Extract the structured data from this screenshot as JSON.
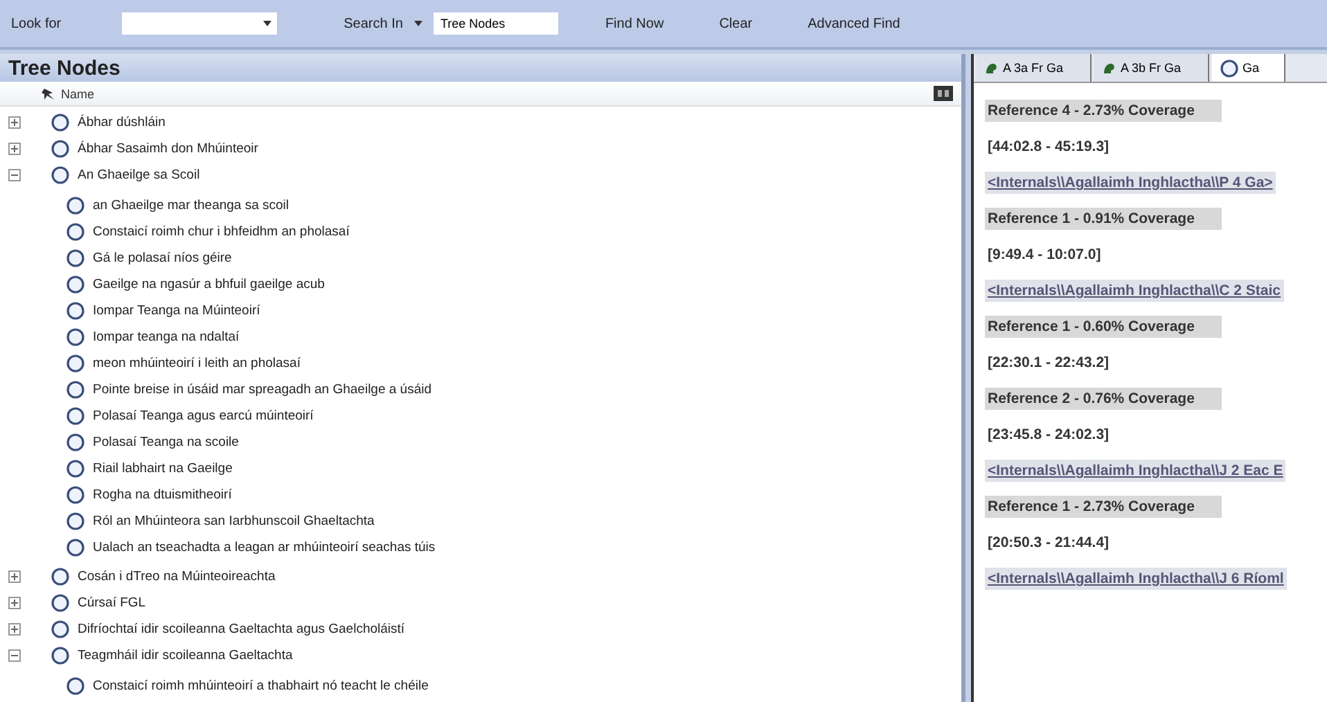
{
  "toolbar": {
    "look_for_label": "Look for",
    "search_in_label": "Search In",
    "search_in": {
      "value": "Tree Nodes"
    },
    "buttons": [
      "Find Now",
      "Clear",
      "Advanced Find"
    ]
  },
  "tree_panel": {
    "title": "Tree Nodes",
    "column": "Name",
    "nodes": [
      {
        "label": "Ábhar dúshláin",
        "expanded": false
      },
      {
        "label": "Ábhar Sasaimh don Mhúinteoir",
        "expanded": false
      },
      {
        "label": "An Ghaeilge sa Scoil",
        "expanded": true,
        "children": [
          {
            "label": "an Ghaeilge mar theanga sa scoil"
          },
          {
            "label": "Constaicí roimh chur i bhfeidhm an pholasaí"
          },
          {
            "label": "Gá le polasaí níos géire"
          },
          {
            "label": "Gaeilge na ngasúr a bhfuil gaeilge acub"
          },
          {
            "label": "Iompar Teanga na Múinteoirí"
          },
          {
            "label": "Iompar teanga na ndaltaí"
          },
          {
            "label": "meon mhúinteoirí i leith an pholasaí"
          },
          {
            "label": "Pointe breise in úsáid mar spreagadh an Ghaeilge a úsáid"
          },
          {
            "label": "Polasaí Teanga agus earcú múinteoirí"
          },
          {
            "label": "Polasaí Teanga na scoile"
          },
          {
            "label": "Riail labhairt na Gaeilge"
          },
          {
            "label": "Rogha na dtuismitheoirí"
          },
          {
            "label": "Ról an Mhúinteora san Iarbhunscoil Ghaeltachta"
          },
          {
            "label": "Ualach an tseachadta a leagan ar mhúinteoirí seachas túis"
          }
        ]
      },
      {
        "label": "Cosán i dTreo na Múinteoireachta",
        "expanded": false
      },
      {
        "label": "Cúrsaí FGL",
        "expanded": false
      },
      {
        "label": "Difríochtaí idir scoileanna Gaeltachta agus Gaelcholáistí",
        "expanded": false
      },
      {
        "label": "Teagmháil idir scoileanna Gaeltachta",
        "expanded": true,
        "children": [
          {
            "label": "Constaicí roimh mhúinteoirí a thabhairt nó teacht le chéile"
          }
        ]
      }
    ]
  },
  "detail_panel": {
    "tabs": [
      {
        "label": "A 3a Fr Ga",
        "kind": "case",
        "selected": false
      },
      {
        "label": "A 3b Fr Ga",
        "kind": "case",
        "selected": false
      },
      {
        "label": "Ga",
        "kind": "node",
        "selected": true
      }
    ],
    "entries": [
      {
        "kind": "reference",
        "text": "Reference 4 - 2.73% Coverage"
      },
      {
        "kind": "range",
        "text": "[44:02.8 - 45:19.3]"
      },
      {
        "kind": "link",
        "text": "<Internals\\\\Agallaimh Inghlactha\\\\P 4 Ga>"
      },
      {
        "kind": "reference",
        "text": "Reference 1 - 0.91% Coverage"
      },
      {
        "kind": "range",
        "text": "[9:49.4 - 10:07.0]"
      },
      {
        "kind": "link",
        "text": "<Internals\\\\Agallaimh Inghlactha\\\\C 2 Staic"
      },
      {
        "kind": "reference",
        "text": "Reference 1 - 0.60% Coverage"
      },
      {
        "kind": "range",
        "text": "[22:30.1 - 22:43.2]"
      },
      {
        "kind": "reference",
        "text": "Reference 2 - 0.76% Coverage"
      },
      {
        "kind": "range",
        "text": "[23:45.8 - 24:02.3]"
      },
      {
        "kind": "link",
        "text": "<Internals\\\\Agallaimh Inghlactha\\\\J 2 Eac E"
      },
      {
        "kind": "reference",
        "text": "Reference 1 - 2.73% Coverage"
      },
      {
        "kind": "range",
        "text": "[20:50.3 - 21:44.4]"
      },
      {
        "kind": "link",
        "text": "<Internals\\\\Agallaimh Inghlactha\\\\J 6 Ríoml"
      }
    ]
  }
}
